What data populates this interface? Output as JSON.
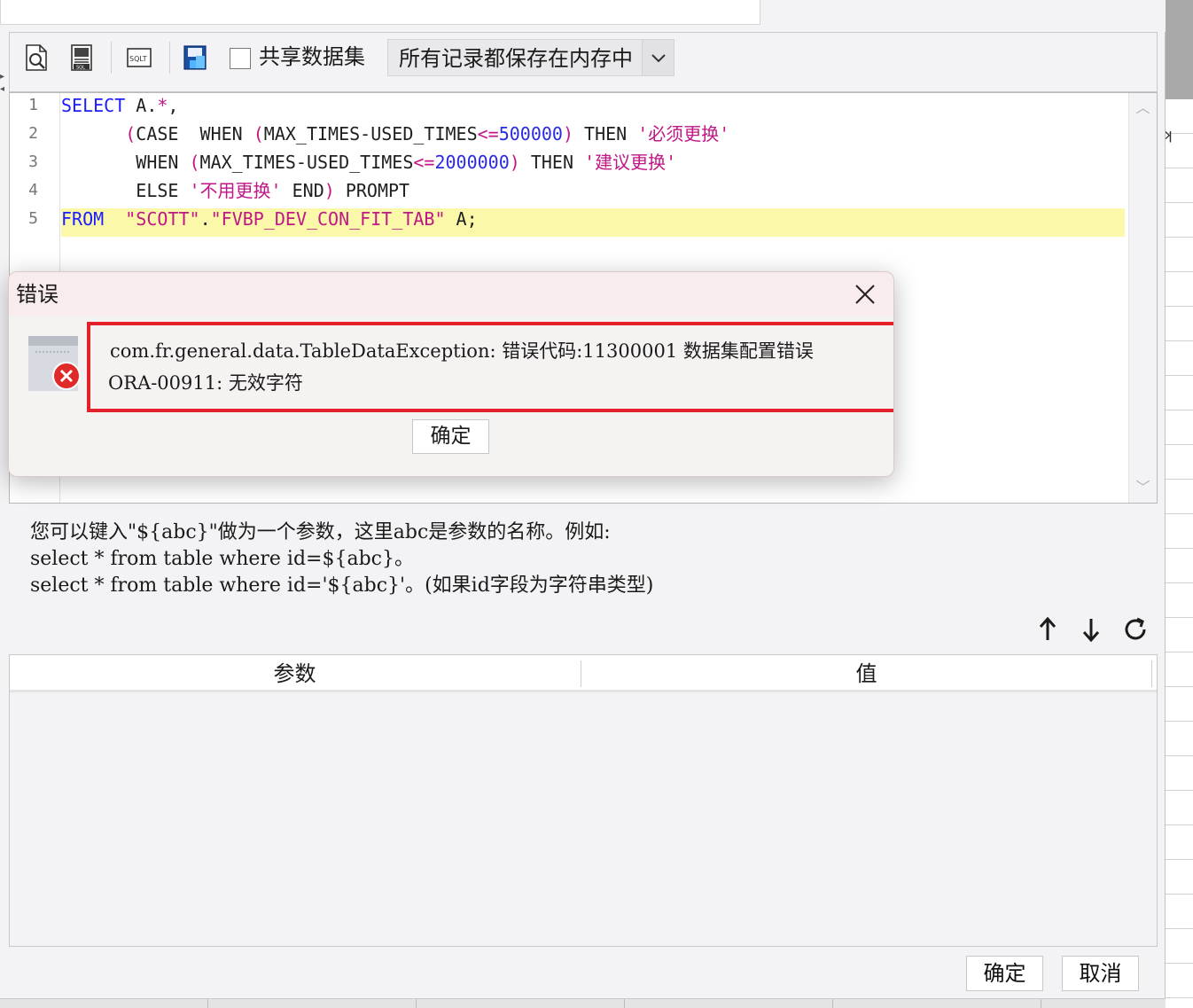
{
  "toolbar": {
    "icons": [
      "preview-icon",
      "sql-icon",
      "sql-format-icon",
      "save-icon"
    ],
    "share_checkbox_label": "共享数据集",
    "share_checked": false,
    "storage_mode": "所有记录都保存在内存中"
  },
  "editor": {
    "lines": [
      {
        "no": "1",
        "text": "SELECT A.*,"
      },
      {
        "no": "2",
        "text": "      (CASE  WHEN (MAX_TIMES-USED_TIMES<=500000) THEN '必须更换'"
      },
      {
        "no": "3",
        "text": "       WHEN (MAX_TIMES-USED_TIMES<=2000000) THEN '建议更换'"
      },
      {
        "no": "4",
        "text": "       ELSE '不用更换' END) PROMPT"
      },
      {
        "no": "5",
        "text": "FROM  \"SCOTT\".\"FVBP_DEV_CON_FIT_TAB\" A;"
      }
    ],
    "highlighted_line": "5"
  },
  "hint": {
    "line1": "您可以键入\"${abc}\"做为一个参数，这里abc是参数的名称。例如:",
    "line2": "select * from table where id=${abc}。",
    "line3": "select * from table where id='${abc}'。(如果id字段为字符串类型)"
  },
  "param_table": {
    "columns": [
      "参数",
      "值"
    ]
  },
  "buttons": {
    "ok": "确定",
    "cancel": "取消"
  },
  "error_dialog": {
    "title": "错误",
    "message_line1": "com.fr.general.data.TableDataException: 错误代码:11300001 数据集配置错误",
    "message_line2": "ORA-00911: 无效字符",
    "ok": "确定"
  },
  "colors": {
    "keyword": "#1c1cff",
    "string": "#c01686",
    "highlight": "#fbf9a9",
    "error_border": "#e4202b"
  }
}
